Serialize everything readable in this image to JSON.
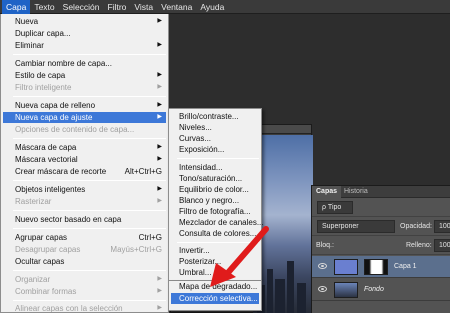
{
  "menubar": {
    "items": [
      "Capa",
      "Texto",
      "Selección",
      "Filtro",
      "Vista",
      "Ventana",
      "Ayuda"
    ]
  },
  "capa_menu": {
    "items": [
      {
        "label": "Nueva",
        "arrow": "▶"
      },
      {
        "label": "Duplicar capa..."
      },
      {
        "label": "Eliminar",
        "arrow": "▶"
      },
      {
        "label": "Cambiar nombre de capa..."
      },
      {
        "label": "Estilo de capa",
        "arrow": "▶"
      },
      {
        "label": "Filtro inteligente",
        "disabled": true,
        "arrow": "▶"
      },
      {
        "label": "Nueva capa de relleno",
        "arrow": "▶"
      },
      {
        "label": "Nueva capa de ajuste",
        "arrow": "▶"
      },
      {
        "label": "Opciones de contenido de capa...",
        "disabled": true
      },
      {
        "label": "Máscara de capa",
        "arrow": "▶"
      },
      {
        "label": "Máscara vectorial",
        "arrow": "▶"
      },
      {
        "label": "Crear máscara de recorte",
        "shortcut": "Alt+Ctrl+G"
      },
      {
        "label": "Objetos inteligentes",
        "arrow": "▶"
      },
      {
        "label": "Rasterizar",
        "disabled": true,
        "arrow": "▶"
      },
      {
        "label": "Nuevo sector basado en capa"
      },
      {
        "label": "Agrupar capas",
        "shortcut": "Ctrl+G"
      },
      {
        "label": "Desagrupar capas",
        "shortcut": "Mayús+Ctrl+G",
        "disabled": true
      },
      {
        "label": "Ocultar capas"
      },
      {
        "label": "Organizar",
        "disabled": true,
        "arrow": "▶"
      },
      {
        "label": "Combinar formas",
        "disabled": true,
        "arrow": "▶"
      },
      {
        "label": "Alinear capas con la selección",
        "disabled": true,
        "arrow": "▶"
      }
    ]
  },
  "ajuste_submenu": {
    "items": [
      {
        "label": "Brillo/contraste..."
      },
      {
        "label": "Niveles..."
      },
      {
        "label": "Curvas..."
      },
      {
        "label": "Exposición..."
      },
      {
        "label": "Intensidad..."
      },
      {
        "label": "Tono/saturación..."
      },
      {
        "label": "Equilibrio de color..."
      },
      {
        "label": "Blanco y negro..."
      },
      {
        "label": "Filtro de fotografía..."
      },
      {
        "label": "Mezclador de canales..."
      },
      {
        "label": "Consulta de colores..."
      },
      {
        "label": "Invertir..."
      },
      {
        "label": "Posterizar..."
      },
      {
        "label": "Umbral..."
      },
      {
        "label": "Mapa de degradado..."
      },
      {
        "label": "Corrección selectiva..."
      }
    ]
  },
  "layers_panel": {
    "tabs": [
      "Capas",
      "Historia"
    ],
    "filter_label": "ρ Tipo",
    "blend_mode": "Superponer",
    "opacity_label": "Opacidad:",
    "opacity_value": "100",
    "lock_label": "Bloq.:",
    "fill_label": "Relleno:",
    "fill_value": "100",
    "layers": [
      {
        "name": "Capa 1",
        "selected": true
      },
      {
        "name": "Fondo",
        "selected": false
      }
    ]
  },
  "colors": {
    "highlight": "#3d78d8",
    "arrow": "#e01b1b"
  }
}
